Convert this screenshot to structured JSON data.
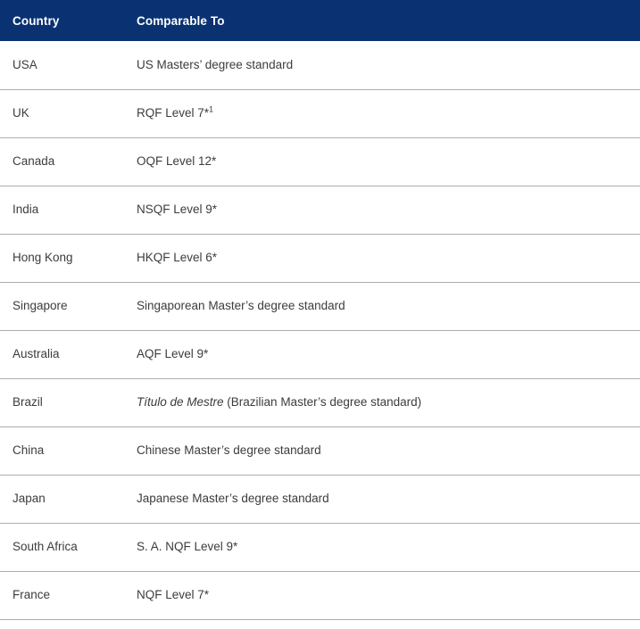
{
  "table": {
    "accent_color": "#0a3272",
    "divider_color": "#adadad",
    "text_color": "#3c3c3c",
    "header_text_color": "#ffffff",
    "columns": [
      {
        "key": "country",
        "label": "Country"
      },
      {
        "key": "comparable",
        "label": "Comparable To"
      }
    ],
    "rows": [
      {
        "country": "USA",
        "comparable": "US Masters’ degree standard",
        "comparable_italic_prefix": "",
        "comparable_superscript": ""
      },
      {
        "country": "UK",
        "comparable": "RQF Level 7*",
        "comparable_italic_prefix": "",
        "comparable_superscript": "1"
      },
      {
        "country": "Canada",
        "comparable": "OQF Level 12*",
        "comparable_italic_prefix": "",
        "comparable_superscript": ""
      },
      {
        "country": "India",
        "comparable": "NSQF Level 9*",
        "comparable_italic_prefix": "",
        "comparable_superscript": ""
      },
      {
        "country": "Hong Kong",
        "comparable": "HKQF Level 6*",
        "comparable_italic_prefix": "",
        "comparable_superscript": ""
      },
      {
        "country": "Singapore",
        "comparable": "Singaporean Master’s degree standard",
        "comparable_italic_prefix": "",
        "comparable_superscript": ""
      },
      {
        "country": "Australia",
        "comparable": "AQF Level 9*",
        "comparable_italic_prefix": "",
        "comparable_superscript": ""
      },
      {
        "country": "Brazil",
        "comparable": " (Brazilian Master’s degree standard)",
        "comparable_italic_prefix": "Título de Mestre",
        "comparable_superscript": ""
      },
      {
        "country": "China",
        "comparable": "Chinese Master’s degree standard",
        "comparable_italic_prefix": "",
        "comparable_superscript": ""
      },
      {
        "country": "Japan",
        "comparable": "Japanese Master’s degree standard",
        "comparable_italic_prefix": "",
        "comparable_superscript": ""
      },
      {
        "country": "South Africa",
        "comparable": "S. A. NQF Level 9*",
        "comparable_italic_prefix": "",
        "comparable_superscript": ""
      },
      {
        "country": "France",
        "comparable": "NQF Level 7*",
        "comparable_italic_prefix": "",
        "comparable_superscript": ""
      }
    ]
  }
}
